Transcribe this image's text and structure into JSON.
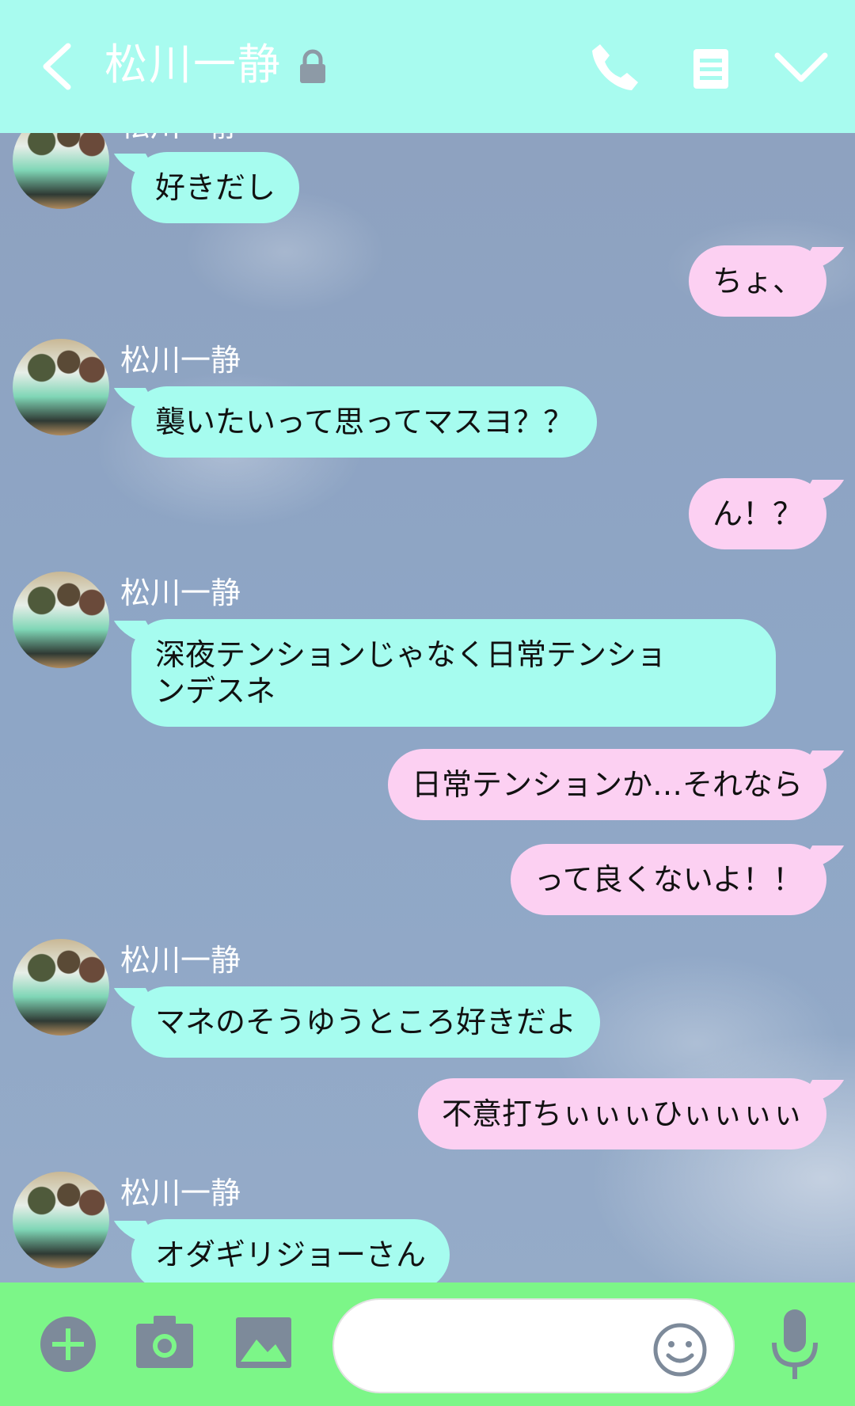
{
  "header": {
    "title": "松川一静",
    "icons": [
      "chevron-left-icon",
      "lock-icon",
      "phone-icon",
      "notes-icon",
      "chevron-down-icon"
    ],
    "background": "#a8fbef"
  },
  "colors": {
    "incoming_bubble": "#a6fcef",
    "outgoing_bubble": "#fcd0f2",
    "footer": "#7cf688",
    "icon_gray": "#7d8a9a"
  },
  "messages": [
    {
      "sender": "",
      "direction": "in",
      "text": "好きだし"
    },
    {
      "sender": "",
      "direction": "out",
      "text": "ちょ、"
    },
    {
      "sender": "松川一静",
      "direction": "in",
      "text": "襲いたいって思ってマスヨ？？"
    },
    {
      "sender": "",
      "direction": "out",
      "text": "ん！？"
    },
    {
      "sender": "松川一静",
      "direction": "in",
      "text": "深夜テンションじゃなく日常テンショ",
      "text2": "ンデスネ"
    },
    {
      "sender": "",
      "direction": "out",
      "text": "日常テンションか…それなら"
    },
    {
      "sender": "",
      "direction": "out",
      "text": "って良くないよ！！"
    },
    {
      "sender": "松川一静",
      "direction": "in",
      "text": "マネのそうゆうところ好きだよ"
    },
    {
      "sender": "",
      "direction": "out",
      "text": "不意打ちぃぃぃひぃぃぃぃ"
    },
    {
      "sender": "松川一静",
      "direction": "in",
      "text": "オダギリジョーさん"
    }
  ],
  "footer": {
    "input_value": "",
    "icons": [
      "plus-icon",
      "camera-icon",
      "image-icon",
      "emoji-icon",
      "mic-icon"
    ]
  }
}
